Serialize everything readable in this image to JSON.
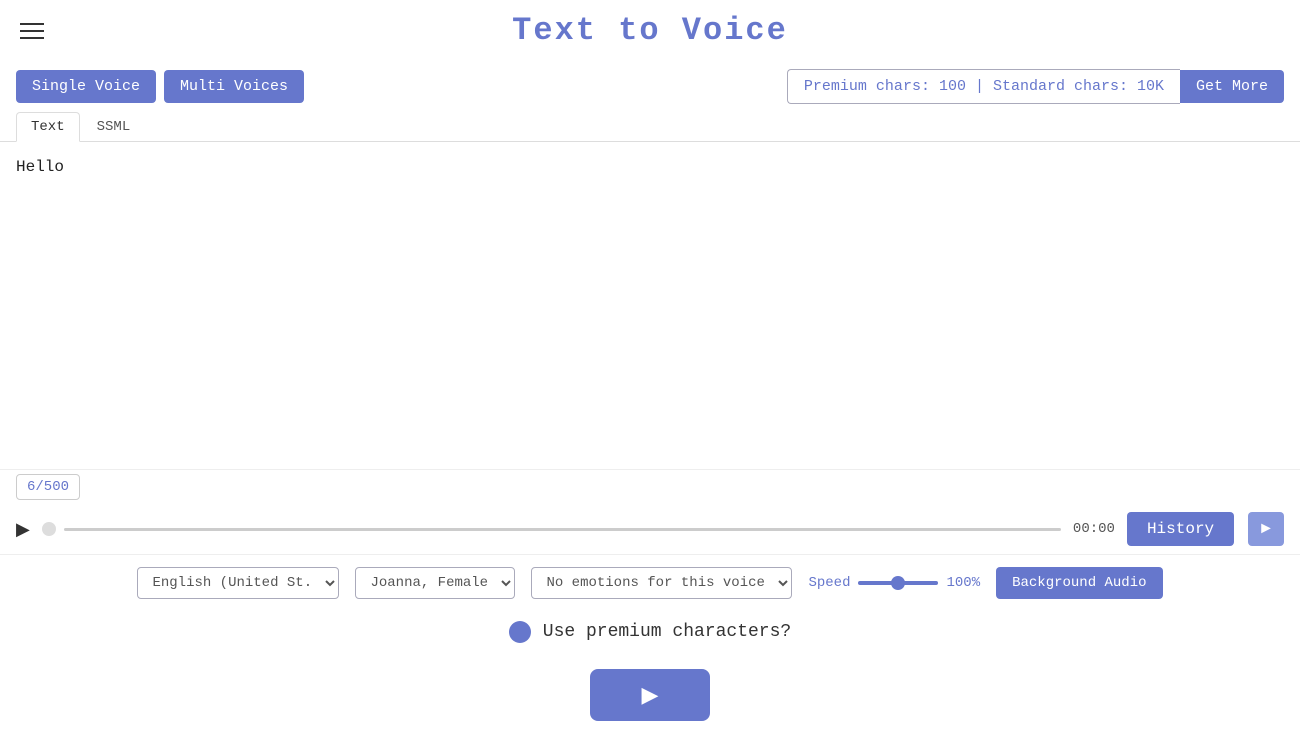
{
  "header": {
    "title": "Text to Voice"
  },
  "topbar": {
    "single_voice_label": "Single Voice",
    "multi_voices_label": "Multi Voices",
    "chars_display": "Premium chars: 100 | Standard chars: 10K",
    "get_more_label": "Get More"
  },
  "tabs": {
    "text_label": "Text",
    "ssml_label": "SSML"
  },
  "editor": {
    "content": "Hello",
    "char_count": "6/500"
  },
  "player": {
    "time": "00:00",
    "history_label": "History"
  },
  "controls": {
    "language_value": "English (United St.",
    "voice_value": "Joanna, Female",
    "emotion_value": "No emotions for this voice",
    "speed_label": "Speed",
    "speed_value": "100%",
    "background_audio_label": "Background Audio"
  },
  "premium": {
    "label": "Use premium characters?"
  },
  "big_play": {
    "symbol": "▶"
  }
}
